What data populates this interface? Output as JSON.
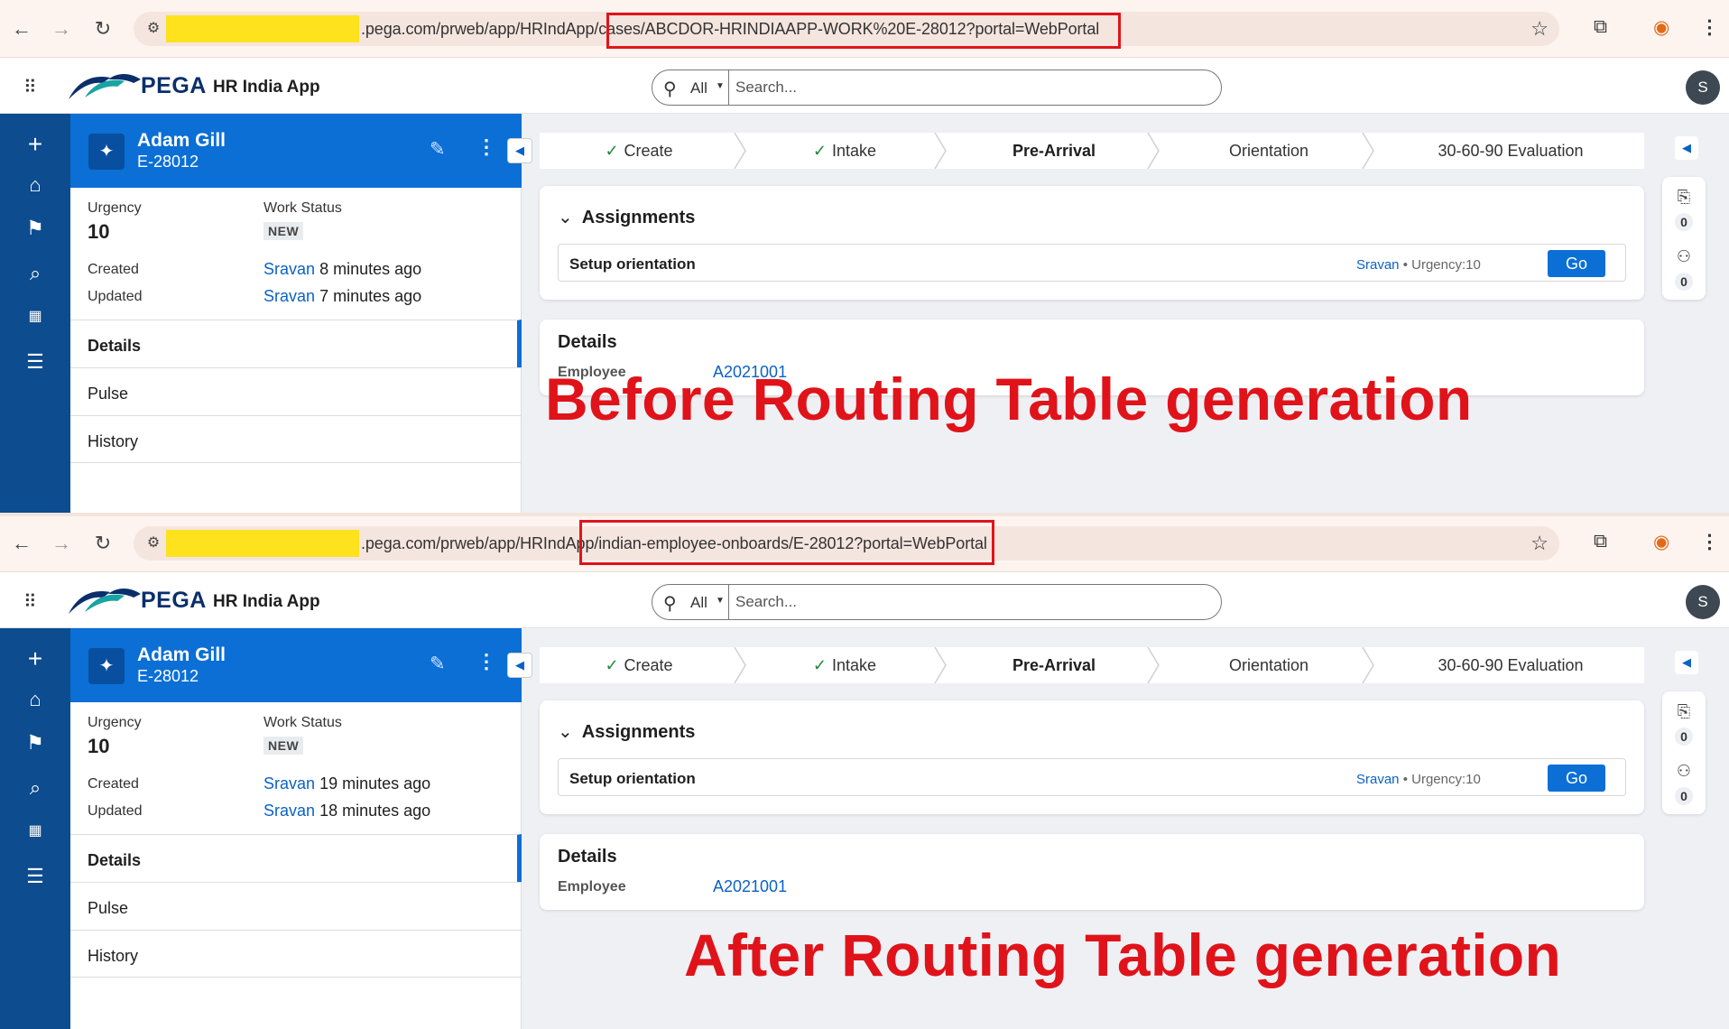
{
  "screens": [
    {
      "browser": {
        "url_visible": ".pega.com/prweb/app/HRIndApp/cases/ABCDOR-HRINDIAAPP-WORK%20E-28012?portal=WebPortal"
      },
      "caption": "Before Routing Table generation",
      "case": {
        "created_time": "8 minutes ago",
        "updated_time": "7 minutes ago"
      },
      "details": {
        "employee_label": "Employee",
        "employee_value": "A2021001"
      }
    },
    {
      "browser": {
        "url_visible": ".pega.com/prweb/app/HRIndApp/indian-employee-onboards/E-28012?portal=WebPortal"
      },
      "caption": "After Routing Table generation",
      "case": {
        "created_time": "19 minutes ago",
        "updated_time": "18 minutes ago"
      },
      "details": {
        "employee_label": "Employee",
        "employee_value": "A2021001"
      }
    }
  ],
  "header": {
    "brand": "PEGA",
    "app_name": "HR India App",
    "search_scope": "All",
    "search_placeholder": "Search...",
    "avatar_initial": "S"
  },
  "case": {
    "name": "Adam Gill",
    "id": "E-28012",
    "urgency_label": "Urgency",
    "urgency_value": "10",
    "work_status_label": "Work Status",
    "work_status_value": "NEW",
    "created_label": "Created",
    "updated_label": "Updated",
    "operator": "Sravan"
  },
  "tabs": [
    "Details",
    "Pulse",
    "History"
  ],
  "stages": [
    {
      "label": "Create",
      "done": true
    },
    {
      "label": "Intake",
      "done": true
    },
    {
      "label": "Pre-Arrival",
      "current": true
    },
    {
      "label": "Orientation"
    },
    {
      "label": "30-60-90 Evaluation"
    }
  ],
  "assignments": {
    "title": "Assignments",
    "task": "Setup orientation",
    "assignee": "Sravan",
    "urgency": "Urgency:10",
    "go_label": "Go"
  },
  "details_title": "Details",
  "utility": {
    "attachments_count": "0",
    "followers_count": "0"
  },
  "colors": {
    "nav_blue": "#0c4c8f",
    "case_header_blue": "#0b6fd6",
    "annotation_red": "#e0131a",
    "redaction_yellow": "#fde21d"
  }
}
